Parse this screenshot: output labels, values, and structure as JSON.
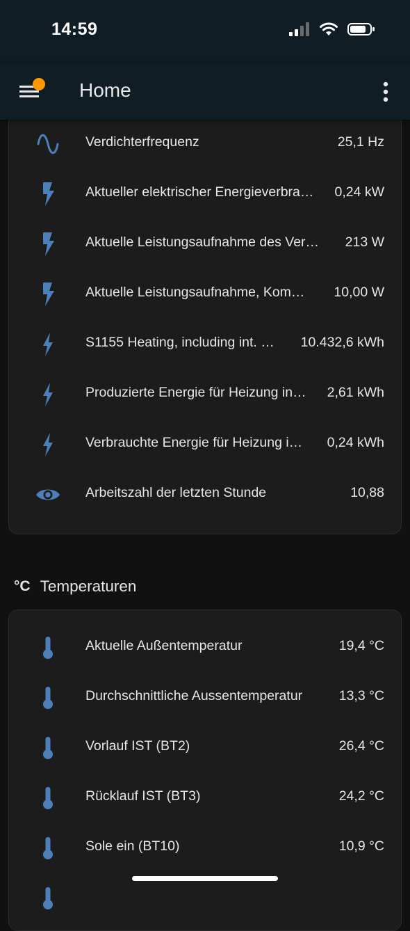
{
  "status_bar": {
    "time": "14:59"
  },
  "app_bar": {
    "title": "Home"
  },
  "top_card": {
    "rows": [
      {
        "icon": "sine-wave-icon",
        "label": "Verdichterfrequenz",
        "value": "25,1 Hz"
      },
      {
        "icon": "flash-icon",
        "label": "Aktueller elektrischer Energieverbra…",
        "value": "0,24 kW"
      },
      {
        "icon": "flash-icon",
        "label": "Aktuelle Leistungsaufnahme des Ver…",
        "value": "213 W"
      },
      {
        "icon": "flash-icon",
        "label": "Aktuelle Leistungsaufnahme, Kom…",
        "value": "10,00 W"
      },
      {
        "icon": "lightning-icon",
        "label": "S1155 Heating, including int. …",
        "value": "10.432,6 kWh"
      },
      {
        "icon": "lightning-icon",
        "label": "Produzierte Energie für Heizung in…",
        "value": "2,61 kWh"
      },
      {
        "icon": "lightning-icon",
        "label": "Verbrauchte Energie für Heizung i…",
        "value": "0,24 kWh"
      },
      {
        "icon": "eye-icon",
        "label": "Arbeitszahl der letzten Stunde",
        "value": "10,88"
      }
    ]
  },
  "temperature_section": {
    "icon_text": "°C",
    "title": "Temperaturen",
    "rows": [
      {
        "icon": "thermometer-icon",
        "label": "Aktuelle Außentemperatur",
        "value": "19,4 °C"
      },
      {
        "icon": "thermometer-icon",
        "label": "Durchschnittliche Aussentemperatur",
        "value": "13,3 °C"
      },
      {
        "icon": "thermometer-icon",
        "label": "Vorlauf IST (BT2)",
        "value": "26,4 °C"
      },
      {
        "icon": "thermometer-icon",
        "label": "Rücklauf IST (BT3)",
        "value": "24,2 °C"
      },
      {
        "icon": "thermometer-icon",
        "label": "Sole ein (BT10)",
        "value": "10,9 °C"
      }
    ]
  },
  "colors": {
    "accent_icon": "#4d7fb8",
    "badge": "#ff9800",
    "appbar": "#101d24"
  }
}
